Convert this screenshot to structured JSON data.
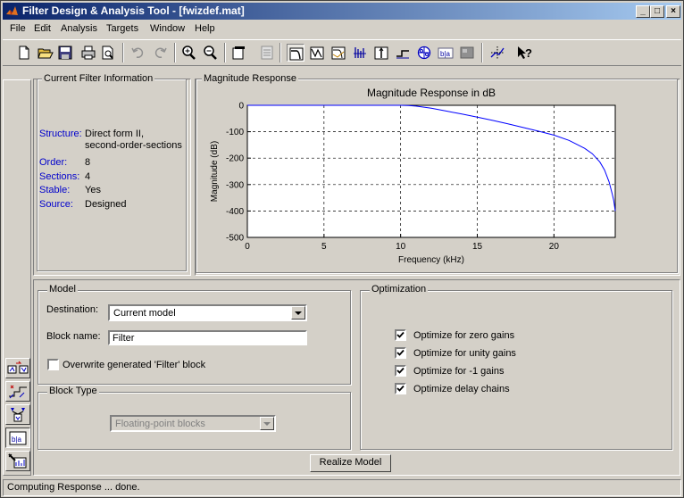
{
  "window": {
    "title": "Filter Design & Analysis Tool - [fwizdef.mat]",
    "minimize_glyph": "_",
    "maximize_glyph": "□",
    "close_glyph": "×"
  },
  "menu": [
    "File",
    "Edit",
    "Analysis",
    "Targets",
    "Window",
    "Help"
  ],
  "toolbar_icons": [
    "new-icon",
    "open-icon",
    "save-icon",
    "print-icon",
    "print-preview-icon",
    "undo-icon",
    "redo-icon",
    "zoom-in-icon",
    "zoom-out-icon",
    "new-figure-icon",
    "legend-icon",
    "magnitude-response-icon",
    "phase-response-icon",
    "magnitude-phase-icon",
    "group-delay-icon",
    "impulse-response-icon",
    "step-response-icon",
    "pole-zero-icon",
    "filter-coefficients-icon",
    "filter-info-icon",
    "full-view-icon",
    "whats-this-icon"
  ],
  "current_filter": {
    "title": "Current Filter Information",
    "structure_label": "Structure:",
    "structure_value_line1": "Direct form II,",
    "structure_value_line2": "second-order-sections",
    "order_label": "Order:",
    "order_value": "8",
    "sections_label": "Sections:",
    "sections_value": "4",
    "stable_label": "Stable:",
    "stable_value": "Yes",
    "source_label": "Source:",
    "source_value": "Designed"
  },
  "magnitude_panel": {
    "title": "Magnitude Response"
  },
  "chart_data": {
    "type": "line",
    "title": "Magnitude Response in dB",
    "xlabel": "Frequency (kHz)",
    "ylabel": "Magnitude (dB)",
    "xlim": [
      0,
      24
    ],
    "ylim": [
      -500,
      0
    ],
    "xticks": [
      0,
      5,
      10,
      15,
      20
    ],
    "yticks": [
      0,
      -100,
      -200,
      -300,
      -400,
      -500
    ],
    "grid": true,
    "line_color": "#0000ff",
    "series": [
      {
        "x": [
          0,
          2,
          4,
          6,
          8,
          9,
          10,
          10.5,
          11,
          12,
          13,
          14,
          15,
          16,
          17,
          18,
          19,
          20,
          21,
          22,
          22.5,
          23,
          23.3,
          23.6,
          23.8,
          23.9,
          24
        ],
        "y": [
          0,
          0,
          0,
          0,
          0,
          0,
          0,
          -1,
          -3,
          -11,
          -22,
          -33,
          -45,
          -57,
          -70,
          -84,
          -98,
          -113,
          -133,
          -163,
          -183,
          -215,
          -245,
          -290,
          -335,
          -360,
          -400
        ]
      }
    ]
  },
  "model": {
    "title": "Model",
    "destination_label": "Destination:",
    "destination_value": "Current model",
    "block_name_label": "Block name:",
    "block_name_value": "Filter",
    "overwrite_label": "Overwrite generated 'Filter' block",
    "overwrite_checked": false
  },
  "block_type": {
    "title": "Block Type",
    "value": "Floating-point blocks"
  },
  "optimization": {
    "title": "Optimization",
    "options": [
      {
        "label": "Optimize for zero gains",
        "checked": true
      },
      {
        "label": "Optimize for unity gains",
        "checked": true
      },
      {
        "label": "Optimize for -1 gains",
        "checked": true
      },
      {
        "label": "Optimize delay chains",
        "checked": true
      }
    ]
  },
  "realize_button": "Realize Model",
  "sidebar_icons": [
    "transform-filter-icon",
    "create-multirate-icon",
    "realize-model-icon",
    "import-filter-icon",
    "pole-zero-editor-icon"
  ],
  "status": "Computing Response ... done."
}
